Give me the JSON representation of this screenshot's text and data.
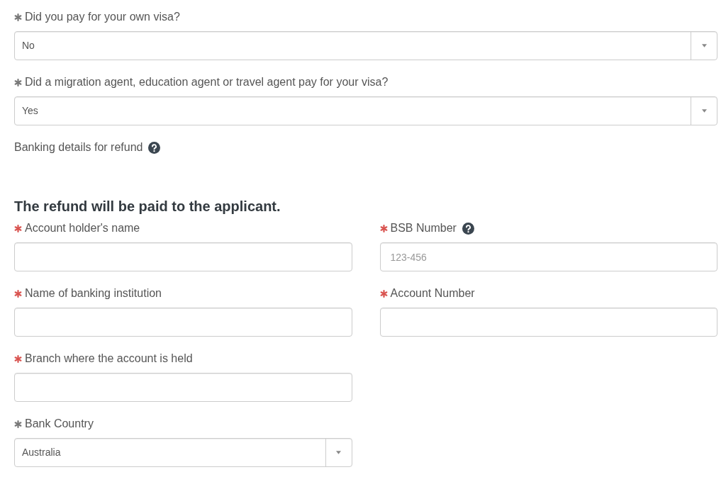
{
  "questions": [
    {
      "label": "Did you pay for your own visa?",
      "answered": true,
      "value": "No"
    },
    {
      "label": "Did a migration agent, education agent or travel agent pay for your visa?",
      "answered": true,
      "value": "Yes"
    }
  ],
  "banking_note": {
    "text": "Banking details for refund",
    "help": true
  },
  "heading": "The refund will be paid to the applicant.",
  "field_rows": [
    [
      {
        "kind": "input",
        "label": "Account holder's name",
        "answered": false
      },
      {
        "kind": "input",
        "label": "BSB Number",
        "answered": false,
        "help": true,
        "placeholder": "123-456"
      }
    ],
    [
      {
        "kind": "input",
        "label": "Name of banking institution",
        "answered": false
      },
      {
        "kind": "input",
        "label": "Account Number",
        "answered": false
      }
    ],
    [
      {
        "kind": "input",
        "label": "Branch where the account is held",
        "answered": false
      }
    ],
    [
      {
        "kind": "select",
        "label": "Bank Country",
        "answered": true,
        "value": "Australia"
      }
    ]
  ]
}
